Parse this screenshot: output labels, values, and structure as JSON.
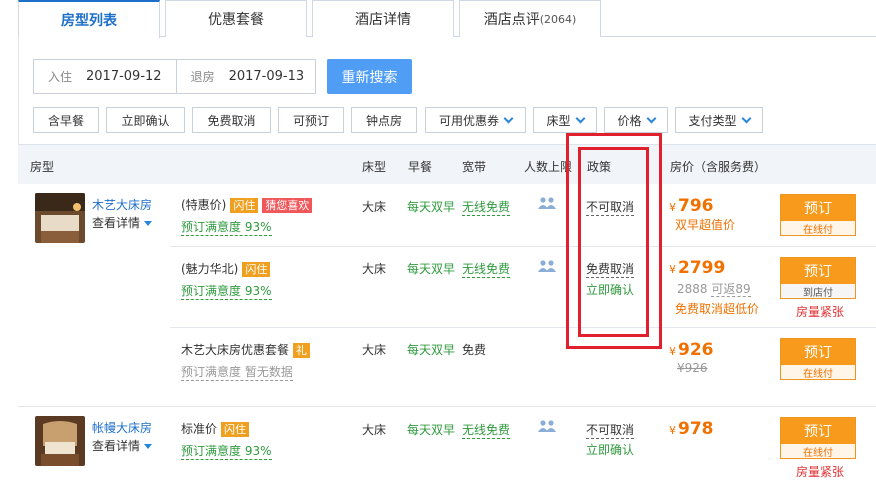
{
  "tabs": [
    {
      "label": "房型列表"
    },
    {
      "label": "优惠套餐"
    },
    {
      "label": "酒店详情"
    },
    {
      "label": "酒店点评",
      "count": "(2064)"
    }
  ],
  "search": {
    "checkin_label": "入住",
    "checkin_value": "2017-09-12",
    "checkout_label": "退房",
    "checkout_value": "2017-09-13",
    "button": "重新搜索"
  },
  "filters": [
    "含早餐",
    "立即确认",
    "免费取消",
    "可预订",
    "钟点房",
    "可用优惠券",
    "床型",
    "价格",
    "支付类型"
  ],
  "table_header": {
    "room": "房型",
    "bed": "床型",
    "breakfast": "早餐",
    "broadband": "宽带",
    "people": "人数上限",
    "policy": "政策",
    "price": "房价（含服务费）"
  },
  "rooms": [
    {
      "name": "木艺大床房",
      "detail": "查看详情",
      "plans": [
        {
          "name": "(特惠价)",
          "badges": [
            "闪住",
            "猜您喜欢"
          ],
          "satisfaction": "预订满意度 93%",
          "bed": "大床",
          "breakfast": "每天双早",
          "broadband": "无线免费",
          "policy": "不可取消",
          "policy2": "",
          "price": "796",
          "price_note": "双早超值价",
          "book": "预订",
          "pay": "在线付",
          "extra": ""
        },
        {
          "name": "(魅力华北)",
          "badges": [
            "闪住"
          ],
          "satisfaction": "预订满意度 93%",
          "bed": "大床",
          "breakfast": "每天双早",
          "broadband": "无线免费",
          "policy": "免费取消",
          "policy2": "立即确认",
          "price": "2799",
          "orig": "2888",
          "rebate": "可返89",
          "price_note": "免费取消超低价",
          "book": "预订",
          "pay": "到店付",
          "extra": "房量紧张"
        },
        {
          "name": "木艺大床房优惠套餐",
          "badges": [
            "礼"
          ],
          "satisfaction": "预订满意度 暂无数据",
          "bed": "大床",
          "breakfast": "每天双早",
          "broadband": "免费",
          "policy": "",
          "policy2": "",
          "price": "926",
          "orig": "¥926",
          "book": "预订",
          "pay": "在线付",
          "extra": ""
        }
      ]
    },
    {
      "name": "帐幔大床房",
      "detail": "查看详情",
      "plans": [
        {
          "name": "标准价",
          "badges": [
            "闪住"
          ],
          "satisfaction": "预订满意度 93%",
          "bed": "大床",
          "breakfast": "每天双早",
          "broadband": "无线免费",
          "policy": "不可取消",
          "policy2": "立即确认",
          "price": "978",
          "book": "预订",
          "pay": "在线付",
          "extra": "房量紧张"
        }
      ]
    }
  ],
  "currency": "¥",
  "colors": {
    "accent": "#1e6fc9",
    "book": "#f89b1c",
    "highlight": "#e0202c",
    "green": "#2e9a3e"
  }
}
